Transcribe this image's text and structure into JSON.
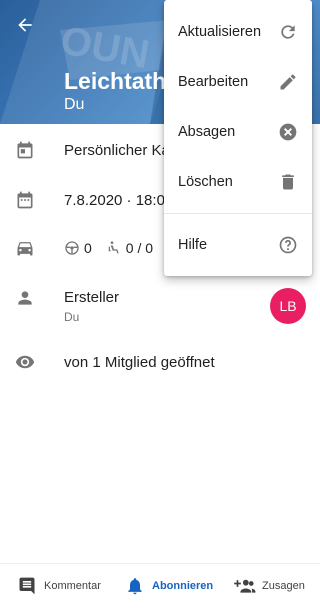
{
  "header": {
    "title": "Leichtath",
    "subtitle": "Du"
  },
  "details": {
    "calendar_name": "Persönlicher Ka",
    "datetime": "7.8.2020 · 18:00",
    "seats_driver": "0",
    "seats_passenger": "0 / 0",
    "creator_label": "Ersteller",
    "creator_name": "Du",
    "creator_initials": "LB",
    "opened_by": "von 1 Mitglied geöffnet"
  },
  "menu": {
    "items": [
      {
        "label": "Aktualisieren",
        "icon": "refresh-icon"
      },
      {
        "label": "Bearbeiten",
        "icon": "pencil-icon"
      },
      {
        "label": "Absagen",
        "icon": "cancel-circle-icon"
      },
      {
        "label": "Löschen",
        "icon": "trash-icon"
      },
      {
        "label": "Hilfe",
        "icon": "help-circle-icon"
      }
    ]
  },
  "bottom_bar": {
    "comment": "Kommentar",
    "subscribe": "Abonnieren",
    "accept": "Zusagen"
  },
  "colors": {
    "header_bg": "#3b79b9",
    "avatar_bg": "#e91e63",
    "active_tab": "#1565c0",
    "icon_gray": "#757575"
  }
}
